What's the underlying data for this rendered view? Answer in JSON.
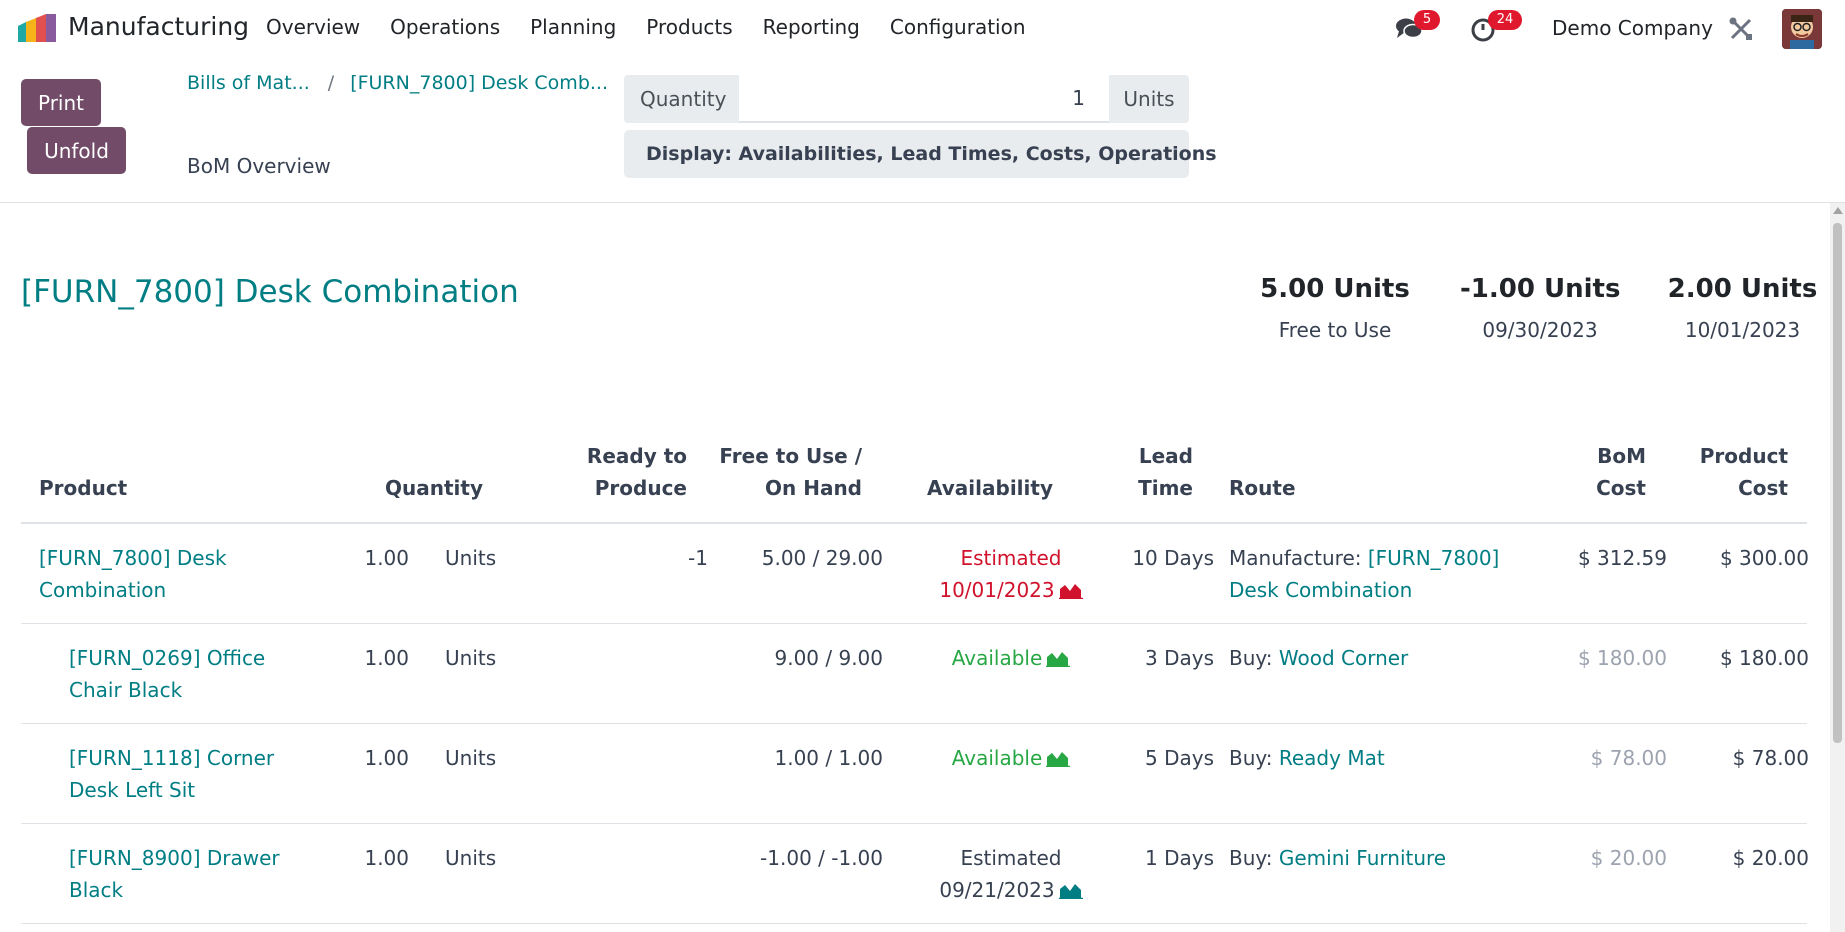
{
  "nav": {
    "app_name": "Manufacturing",
    "menu": [
      "Overview",
      "Operations",
      "Planning",
      "Products",
      "Reporting",
      "Configuration"
    ],
    "chat_badge": "5",
    "activity_badge": "24",
    "company": "Demo Company"
  },
  "control": {
    "print_label": "Print",
    "unfold_label": "Unfold",
    "breadcrumb": [
      "Bills of Mat...",
      "[FURN_7800] Desk Comb..."
    ],
    "subtitle": "BoM Overview",
    "quantity_label": "Quantity",
    "quantity_value": "1",
    "quantity_unit": "Units",
    "display_label": "Display: Availabilities, Lead Times, Costs, Operations"
  },
  "report": {
    "title": "[FURN_7800] Desk Combination",
    "summary": [
      {
        "value": "5.00 Units",
        "label": "Free to Use"
      },
      {
        "value": "-1.00 Units",
        "label": "09/30/2023"
      },
      {
        "value": "2.00 Units",
        "label": "10/01/2023"
      }
    ]
  },
  "table": {
    "headers": {
      "product": "Product",
      "quantity": "Quantity",
      "ready_1": "Ready to",
      "ready_2": "Produce",
      "free_1": "Free to Use /",
      "free_2": "On Hand",
      "availability": "Availability",
      "lead_1": "Lead",
      "lead_2": "Time",
      "route": "Route",
      "bom_1": "BoM",
      "bom_2": "Cost",
      "prod_1": "Product",
      "prod_2": "Cost"
    },
    "rows": [
      {
        "product_1": "[FURN_7800] Desk",
        "product_2": "Combination",
        "qty": "1.00",
        "uom": "Units",
        "ready": "-1",
        "free_on_hand": "5.00 / 29.00",
        "avail_1": "Estimated",
        "avail_2": "10/01/2023",
        "lead": "10 Days",
        "route_prefix": "Manufacture: ",
        "route_link_1": "[FURN_7800]",
        "route_link_2": "Desk Combination",
        "bom_cost": "$ 312.59",
        "product_cost": "$ 300.00"
      },
      {
        "product_1": "[FURN_0269] Office",
        "product_2": "Chair Black",
        "qty": "1.00",
        "uom": "Units",
        "free_on_hand": "9.00 / 9.00",
        "avail": "Available",
        "lead": "3 Days",
        "route_prefix": "Buy: ",
        "route_link": "Wood Corner",
        "bom_cost": "$ 180.00",
        "product_cost": "$ 180.00"
      },
      {
        "product_1": "[FURN_1118] Corner",
        "product_2": "Desk Left Sit",
        "qty": "1.00",
        "uom": "Units",
        "free_on_hand": "1.00 / 1.00",
        "avail": "Available",
        "lead": "5 Days",
        "route_prefix": "Buy: ",
        "route_link": "Ready Mat",
        "bom_cost": "$ 78.00",
        "product_cost": "$ 78.00"
      },
      {
        "product_1": "[FURN_8900] Drawer",
        "product_2": "Black",
        "qty": "1.00",
        "uom": "Units",
        "free_on_hand": "-1.00 / -1.00",
        "avail_1": "Estimated",
        "avail_2": "09/21/2023",
        "lead": "1 Days",
        "route_prefix": "Buy: ",
        "route_link": "Gemini Furniture",
        "bom_cost": "$ 20.00",
        "product_cost": "$ 20.00"
      }
    ]
  },
  "colors": {
    "brand": "#714b67",
    "link": "#017e84",
    "danger": "#d0122c",
    "success": "#28a745"
  }
}
